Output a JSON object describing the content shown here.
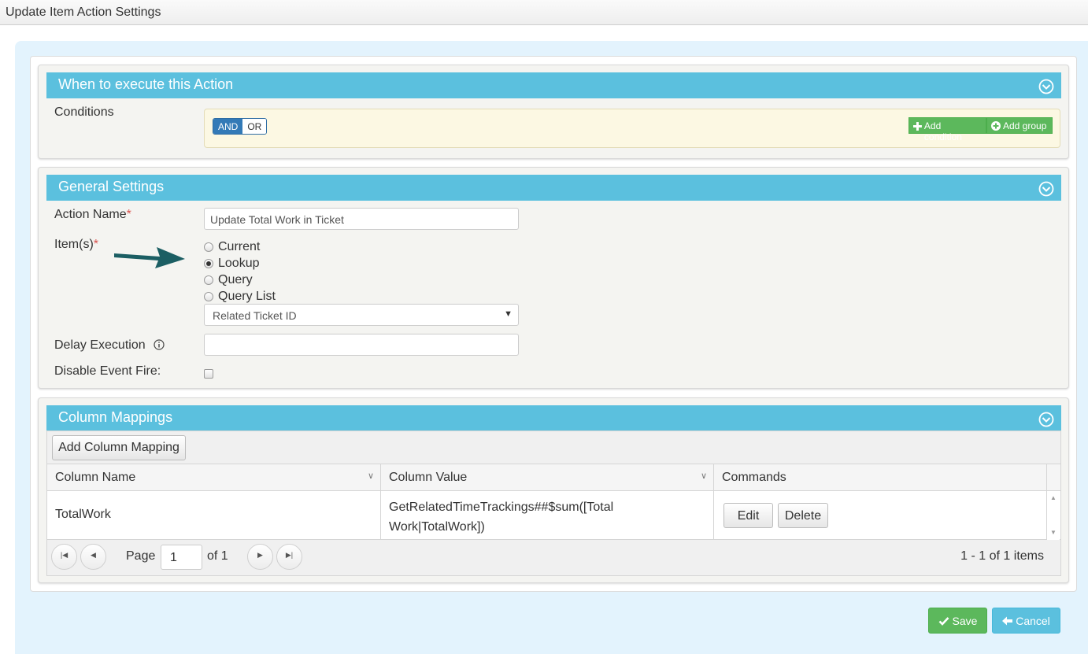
{
  "window": {
    "title": "Update Item Action Settings"
  },
  "when_section": {
    "title": "When to execute this Action",
    "conditions_label": "Conditions",
    "and_label": "AND",
    "or_label": "OR",
    "add_condition_label": "Add condition",
    "add_group_label": "Add group"
  },
  "general": {
    "title": "General Settings",
    "action_name_label": "Action Name",
    "action_name_value": "Update Total Work in Ticket",
    "items_label": "Item(s)",
    "required_mark": "*",
    "radio_options": [
      "Current",
      "Lookup",
      "Query",
      "Query List"
    ],
    "selected_option": "Lookup",
    "lookup_select_value": "Related Ticket ID",
    "delay_label": "Delay Execution",
    "delay_value": "",
    "disable_event_label": "Disable Event Fire:",
    "disable_event_checked": false
  },
  "mappings": {
    "title": "Column Mappings",
    "add_button_label": "Add Column Mapping",
    "columns": [
      "Column Name",
      "Column Value",
      "Commands"
    ],
    "rows": [
      {
        "name": "TotalWork",
        "value_line1": "GetRelatedTimeTrackings##$sum([Total",
        "value_line2": "Work|TotalWork])",
        "edit_label": "Edit",
        "delete_label": "Delete"
      }
    ],
    "pager": {
      "page_label": "Page",
      "page_value": "1",
      "of_label": "of 1",
      "summary": "1 - 1 of 1 items"
    }
  },
  "footer": {
    "save_label": "Save",
    "cancel_label": "Cancel"
  },
  "colors": {
    "header": "#5bc0de",
    "green": "#5cb85c",
    "blue_dark": "#337ab7",
    "arrow": "#1b5e63",
    "outer_bg": "#e3f3fd"
  }
}
